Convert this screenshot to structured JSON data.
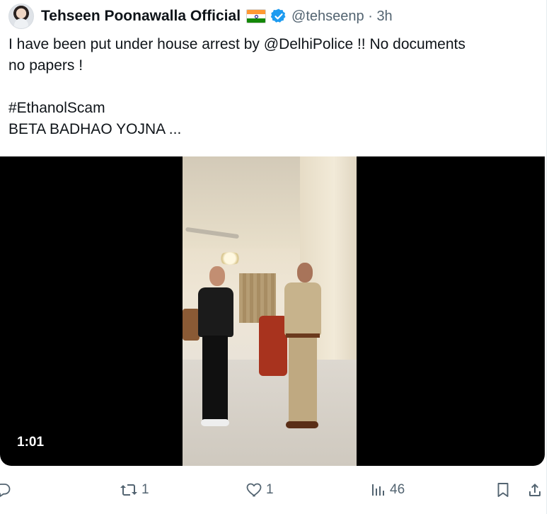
{
  "tweet": {
    "author_name": "Tehseen Poonawalla Official",
    "flag_emoji": "india-flag",
    "verified": true,
    "handle": "@tehseenp",
    "separator": "·",
    "time": "3h",
    "text_line1_a": "I have been put under house arrest by ",
    "text_mention": "@DelhiPolice",
    "text_line1_b": " !! No documents",
    "text_line2": "no papers !",
    "text_hashtag": "#EthanolScam",
    "text_line4": "BETA BADHAO YOJNA ..."
  },
  "video": {
    "duration": "1:01"
  },
  "actions": {
    "reply_count": "",
    "retweet_count": "1",
    "like_count": "1",
    "views_count": "46"
  },
  "colors": {
    "text": "#0f1419",
    "secondary": "#536471",
    "verified_blue": "#1d9bf0"
  },
  "icons": [
    "reply-icon",
    "retweet-icon",
    "like-icon",
    "views-icon",
    "bookmark-icon",
    "share-icon"
  ]
}
